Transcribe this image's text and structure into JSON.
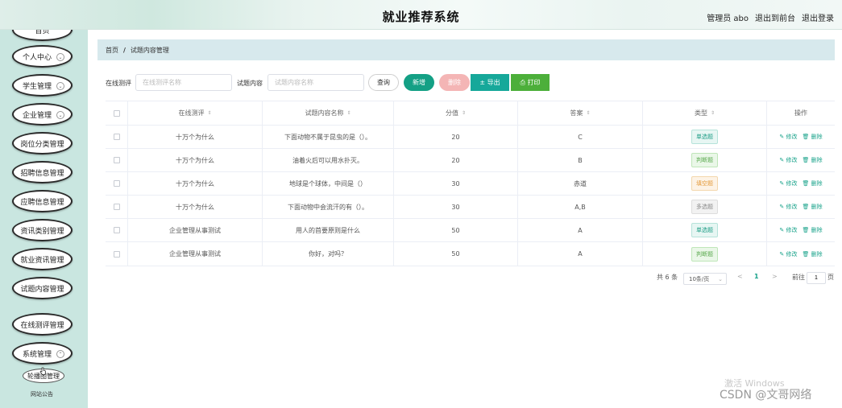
{
  "header": {
    "title": "就业推荐系统",
    "admin": "管理员 abo",
    "back_front": "退出到前台",
    "logout": "退出登录"
  },
  "sidebar": {
    "top_partial": "首页",
    "items": [
      {
        "label": "个人中心"
      },
      {
        "label": "学生管理"
      },
      {
        "label": "企业管理"
      },
      {
        "label": "岗位分类管理"
      },
      {
        "label": "招聘信息管理"
      },
      {
        "label": "应聘信息管理"
      },
      {
        "label": "资讯类别管理"
      },
      {
        "label": "就业资讯管理"
      },
      {
        "label": "试题内容管理"
      },
      {
        "label": "在线测评管理"
      },
      {
        "label": "系统管理"
      }
    ],
    "sub_item": "轮播图管理",
    "sub_partial": "网站公告"
  },
  "breadcrumb": {
    "home": "首页",
    "sep": "/",
    "current": "试题内容管理"
  },
  "search": {
    "label1": "在线测评",
    "placeholder1": "在线测评名称",
    "label2": "试题内容",
    "placeholder2": "试题内容名称",
    "query": "查询",
    "add": "新增",
    "delete": "删除",
    "export": "± 导出",
    "print": "⎙ 打印"
  },
  "table": {
    "columns": [
      "在线测评",
      "试题内容名称",
      "分值",
      "答案",
      "类型",
      "操作"
    ],
    "sort_icon": "⇕",
    "edit": "✎ 修改",
    "remove": "🗑 删除",
    "rows": [
      {
        "exam": "十万个为什么",
        "name": "下面动物不属于昆虫的是（）。",
        "score": "20",
        "answer": "C",
        "type": "单选题",
        "type_class": "single"
      },
      {
        "exam": "十万个为什么",
        "name": "油着火后可以用水扑灭。",
        "score": "20",
        "answer": "B",
        "type": "判断题",
        "type_class": "judge"
      },
      {
        "exam": "十万个为什么",
        "name": "地球是个球体，中间是（）",
        "score": "30",
        "answer": "赤道",
        "type": "填空题",
        "type_class": "fill"
      },
      {
        "exam": "十万个为什么",
        "name": "下面动物中会流汗的有（）。",
        "score": "30",
        "answer": "A,B",
        "type": "多选题",
        "type_class": "multi"
      },
      {
        "exam": "企业管理从事测试",
        "name": "用人的首要原则是什么",
        "score": "50",
        "answer": "A",
        "type": "单选题",
        "type_class": "single"
      },
      {
        "exam": "企业管理从事测试",
        "name": "你好，对吗？",
        "score": "50",
        "answer": "A",
        "type": "判断题",
        "type_class": "judge"
      }
    ]
  },
  "pager": {
    "total": "共 6 条",
    "size": "10条/页",
    "prev": "<",
    "page": "1",
    "next": ">",
    "goto": "前往",
    "goto_value": "1",
    "unit": "页"
  },
  "watermark": {
    "activate": "激活 Windows",
    "csdn": "CSDN @文哥网络"
  }
}
